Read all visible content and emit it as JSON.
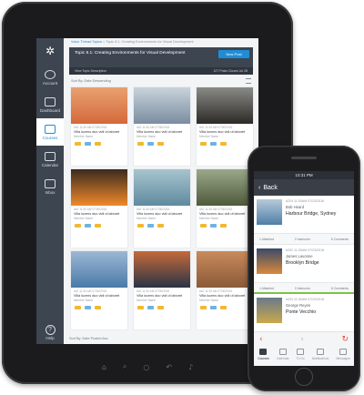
{
  "tablet": {
    "logo_icon": "canvas-logo-icon",
    "nav": [
      {
        "label": "Account",
        "icon": "account-icon"
      },
      {
        "label": "Dashboard",
        "icon": "dashboard-icon"
      },
      {
        "label": "Courses",
        "icon": "courses-icon",
        "active": true
      },
      {
        "label": "Calendar",
        "icon": "calendar-icon"
      },
      {
        "label": "Inbox",
        "icon": "inbox-icon"
      }
    ],
    "help_label": "Help",
    "breadcrumb": {
      "link": "Voice Thread Topics",
      "sep": ">",
      "current": "Topic 8.1: Creating Environments for Visual Development"
    },
    "header_title": "Topic 8.1: Creating Environments for Visual Development",
    "new_post_label": "New Post",
    "subbar_left": "View Topic Description",
    "subbar_right": "127 Posts   Closes Jul 28",
    "sort_label": "Sort By:   Date Descending",
    "footer_label": "Sort By:   Date Posted Asc",
    "card_caption": "Villa lucens duo vidi ut laboret",
    "card_author": "Member Name",
    "card_meta": "#42   11:30 AM   07/30/2016",
    "image_colors": [
      [
        "#d4693b",
        "#e8a170"
      ],
      [
        "#7a8da0",
        "#c9d3dc"
      ],
      [
        "#2c2a26",
        "#8a8a86"
      ],
      [
        "#f08a2a",
        "#3a2a1e"
      ],
      [
        "#5f8a9e",
        "#a7c4cf"
      ],
      [
        "#4e5a3a",
        "#9aa88a"
      ],
      [
        "#4a7aa8",
        "#9bb8d4"
      ],
      [
        "#2a3446",
        "#c46a3a"
      ],
      [
        "#8a5a3a",
        "#c98a5a"
      ]
    ]
  },
  "phone": {
    "status_time": "10:31 PM",
    "back_label": "Back",
    "items": [
      {
        "meta": "#224   11:30AM   07/23/2016",
        "author": "Bob Heard",
        "title": "Harbour Bridge, Sydney",
        "attached": "1 Attached",
        "instructor": "0 Instructor",
        "comments": "6 Comments",
        "thumb": [
          "#4e7fa8",
          "#b8c9d8"
        ],
        "active": false
      },
      {
        "meta": "#202   11:30AM   07/23/2016",
        "author": "James Lavonne",
        "title": "Brooklyn Bridge",
        "attached": "1 Attached",
        "instructor": "0 Instructor",
        "comments": "6 Comments",
        "thumb": [
          "#d98a3a",
          "#3a4a6a"
        ],
        "active": true
      },
      {
        "meta": "#203   11:30AM   07/23/2016",
        "author": "George Reyes",
        "title": "Ponte Vecchio",
        "attached": "1 Attached",
        "instructor": "0 Instructor",
        "comments": "6 Comments",
        "thumb": [
          "#c9a84a",
          "#6a7a8a"
        ],
        "active": false
      }
    ],
    "tabs": [
      {
        "label": "Courses",
        "active": true
      },
      {
        "label": "Calendar",
        "active": false
      },
      {
        "label": "To Do",
        "active": false
      },
      {
        "label": "Notifications",
        "active": false
      },
      {
        "label": "Messages",
        "active": false
      }
    ]
  }
}
